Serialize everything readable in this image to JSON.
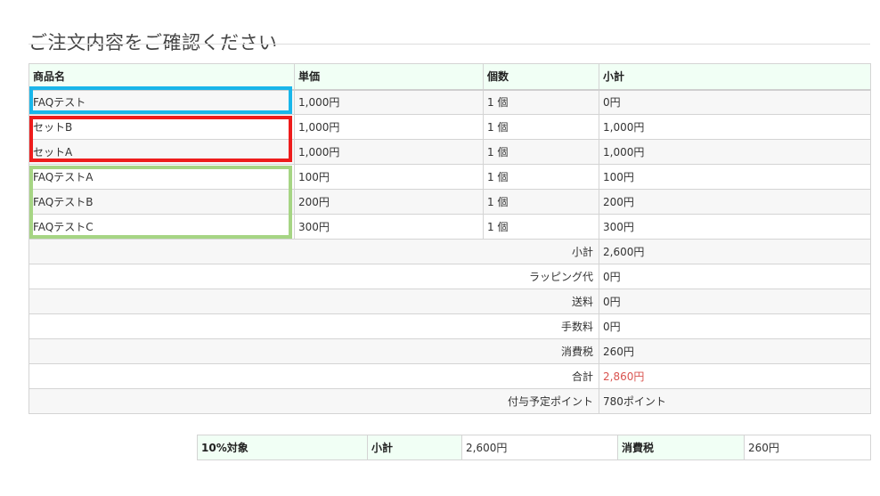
{
  "page": {
    "title": "ご注文内容をご確認ください"
  },
  "order": {
    "headers": [
      "商品名",
      "単価",
      "個数",
      "小計"
    ],
    "items": [
      {
        "name": "FAQテスト",
        "unit_price": "1,000円",
        "qty": "1 個",
        "subtotal": "0円"
      },
      {
        "name": "セットB",
        "unit_price": "1,000円",
        "qty": "1 個",
        "subtotal": "1,000円"
      },
      {
        "name": "セットA",
        "unit_price": "1,000円",
        "qty": "1 個",
        "subtotal": "1,000円"
      },
      {
        "name": "FAQテストA",
        "unit_price": "100円",
        "qty": "1 個",
        "subtotal": "100円"
      },
      {
        "name": "FAQテストB",
        "unit_price": "200円",
        "qty": "1 個",
        "subtotal": "200円"
      },
      {
        "name": "FAQテストC",
        "unit_price": "300円",
        "qty": "1 個",
        "subtotal": "300円"
      }
    ],
    "summary": [
      {
        "label": "小計",
        "value": "2,600円"
      },
      {
        "label": "ラッピング代",
        "value": "0円"
      },
      {
        "label": "送料",
        "value": "0円"
      },
      {
        "label": "手数料",
        "value": "0円"
      },
      {
        "label": "消費税",
        "value": "260円"
      },
      {
        "label": "合計",
        "value": "2,860円"
      },
      {
        "label": "付与予定ポイント",
        "value": "780ポイント"
      }
    ]
  },
  "tax": {
    "target_label": "10%対象",
    "subtotal_label": "小計",
    "subtotal_value": "2,600円",
    "tax_label": "消費税",
    "tax_value": "260円"
  },
  "colors": {
    "highlight_blue": "#19b6ea",
    "highlight_red": "#ee1c1c",
    "highlight_green": "#a6d584",
    "total_value": "#d9534f",
    "header_bg": "#f1fff5"
  }
}
